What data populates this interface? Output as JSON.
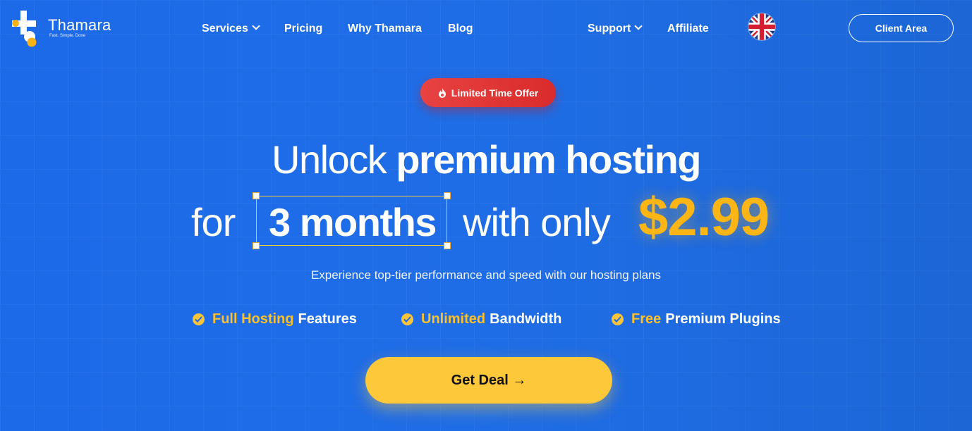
{
  "brand": {
    "name": "Thamara",
    "tagline": "Fast. Simple. Done"
  },
  "nav": {
    "services": "Services",
    "pricing": "Pricing",
    "why": "Why Thamara",
    "blog": "Blog",
    "support": "Support",
    "affiliate": "Affiliate",
    "language_icon": "uk-flag-icon",
    "client_area": "Client Area"
  },
  "hero": {
    "badge": "Limited Time Offer",
    "line1_light": "Unlock ",
    "line1_bold": "premium hosting",
    "for_word": "for",
    "months": "3 months",
    "with_only": "with only",
    "price": "$2.99",
    "subtitle": "Experience top-tier performance and speed with our hosting plans",
    "features": [
      {
        "highlight": "Full Hosting",
        "rest": "Features"
      },
      {
        "highlight": "Unlimited",
        "rest": "Bandwidth"
      },
      {
        "highlight": "Free",
        "rest": "Premium Plugins"
      }
    ],
    "cta": "Get Deal →"
  },
  "colors": {
    "background": "#1d6ae8",
    "accent_yellow": "#fbb615",
    "badge_red": "#e03434",
    "cta_yellow": "#fdc83a"
  }
}
